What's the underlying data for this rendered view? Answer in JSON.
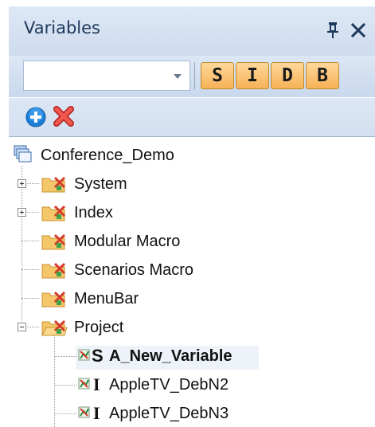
{
  "panel": {
    "title": "Variables",
    "pin_glyph": "📌",
    "close_glyph": "✕"
  },
  "toolbar": {
    "combo_value": "",
    "filters": [
      "S",
      "I",
      "D",
      "B"
    ]
  },
  "actions": {
    "add_icon": "add-circle-icon",
    "delete_icon": "delete-x-icon"
  },
  "tree": {
    "root": "Conference_Demo",
    "folders": [
      "System",
      "Index",
      "Modular Macro",
      "Scenarios Macro",
      "MenuBar",
      "Project"
    ],
    "project_children": [
      {
        "label": "A_New_Variable",
        "type_glyph": "S",
        "bold": true
      },
      {
        "label": "AppleTV_DebN2",
        "type_glyph": "I",
        "bold": false
      },
      {
        "label": "AppleTV_DebN3",
        "type_glyph": "I",
        "bold": false
      }
    ]
  },
  "colors": {
    "header_bg": "#dde8f6",
    "title_text": "#1e395b",
    "filter_button": "#f6b257",
    "add_blue": "#1c7fd6",
    "delete_red": "#e2403a"
  }
}
